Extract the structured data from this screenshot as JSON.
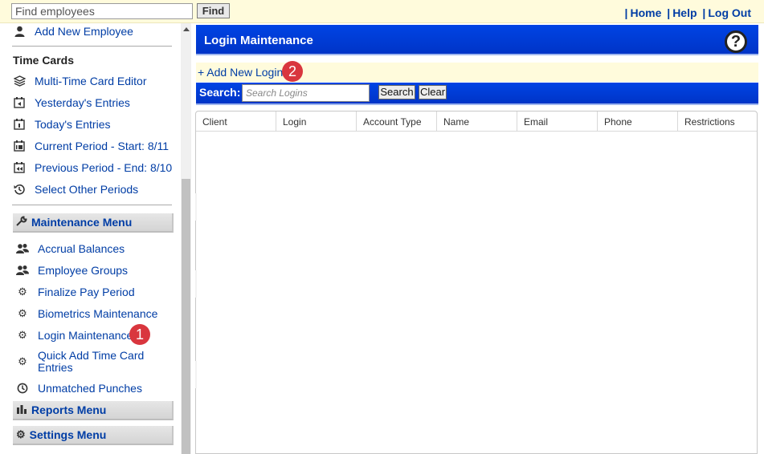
{
  "topbar": {
    "find_placeholder": "Find employees",
    "find_button": "Find",
    "links": [
      {
        "label": "Home"
      },
      {
        "label": "Help"
      },
      {
        "label": "Log Out"
      }
    ],
    "separator": "|",
    "background": "#fffbdc"
  },
  "sidebar": {
    "add_employee": {
      "label": "Add New Employee",
      "icon": "person-icon"
    },
    "time_cards_title": "Time Cards",
    "time_card_items": [
      {
        "label": "Multi-Time Card Editor",
        "icon": "layers-icon"
      },
      {
        "label": "Yesterday's Entries",
        "icon": "calendar-back-icon"
      },
      {
        "label": "Today's Entries",
        "icon": "calendar-day-icon"
      },
      {
        "label": "Current Period - Start: 8/11",
        "icon": "calendar-14-icon"
      },
      {
        "label": "Previous Period - End: 8/10",
        "icon": "calendar-rewind-icon"
      },
      {
        "label": "Select Other Periods",
        "icon": "history-icon"
      }
    ],
    "maintenance_menu": {
      "label": "Maintenance Menu",
      "icon": "wrench-icon"
    },
    "maintenance_items": [
      {
        "label": "Accrual Balances",
        "icon": "users-icon"
      },
      {
        "label": "Employee Groups",
        "icon": "users-icon"
      },
      {
        "label": "Finalize Pay Period",
        "icon": "gear-icon"
      },
      {
        "label": "Biometrics Maintenance",
        "icon": "gear-icon"
      },
      {
        "label": "Login Maintenance",
        "icon": "gear-icon"
      },
      {
        "label": "Quick Add Time Card",
        "label2": "Entries",
        "icon": "gear-icon"
      },
      {
        "label": "Unmatched Punches",
        "icon": "clock-icon"
      }
    ],
    "reports_menu": {
      "label": "Reports Menu",
      "icon": "bar-chart-icon"
    },
    "settings_menu": {
      "label": "Settings Menu",
      "icon": "gear-icon"
    }
  },
  "main": {
    "title": "Login Maintenance",
    "help_icon": "?",
    "add_login": "+ Add New Login",
    "search": {
      "label": "Search:",
      "placeholder": "Search Logins",
      "search_button": "Search",
      "clear_button": "Clear"
    },
    "table": {
      "columns": [
        "Client",
        "Login",
        "Account Type",
        "Name",
        "Email",
        "Phone",
        "Restrictions"
      ],
      "rows": []
    }
  },
  "badges": {
    "first": "1",
    "second": "2",
    "color": "#d9363e"
  },
  "colors": {
    "accent_blue": "#0039d6",
    "link_blue": "#003da5"
  }
}
